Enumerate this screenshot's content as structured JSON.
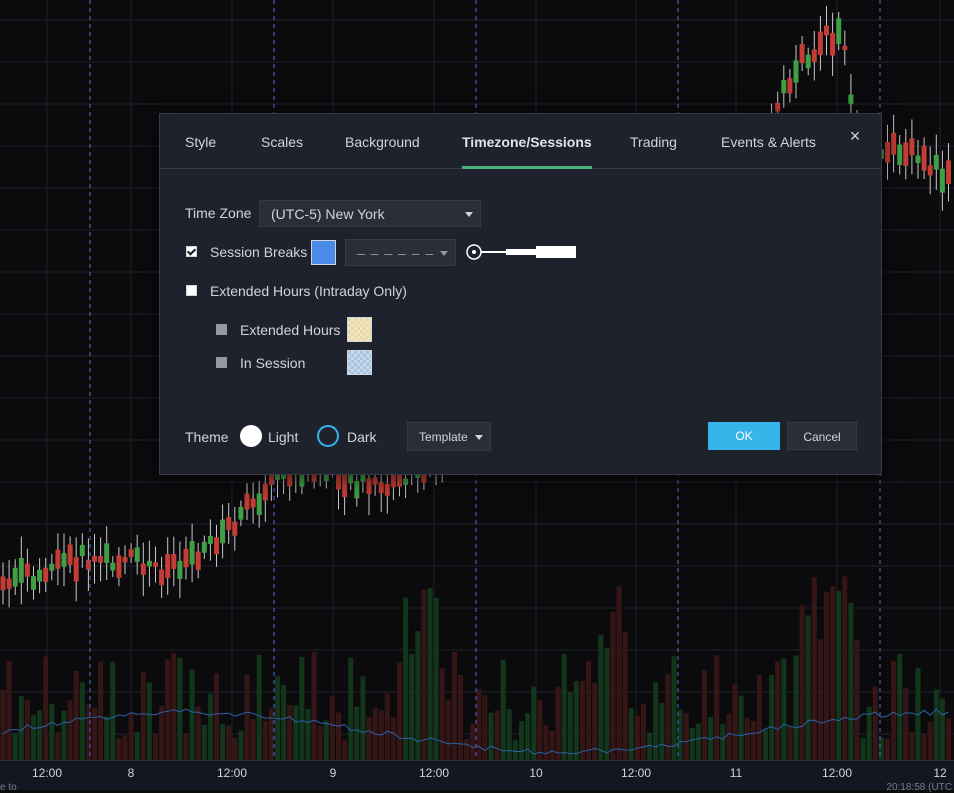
{
  "dialog": {
    "tabs": [
      {
        "label": "Style"
      },
      {
        "label": "Scales"
      },
      {
        "label": "Background"
      },
      {
        "label": "Timezone/Sessions"
      },
      {
        "label": "Trading"
      },
      {
        "label": "Events & Alerts"
      }
    ],
    "active_tab": "Timezone/Sessions",
    "close_symbol": "×",
    "timezone": {
      "label": "Time Zone",
      "value": "(UTC-5) New York"
    },
    "session_breaks": {
      "label": "Session Breaks",
      "checked": true,
      "color": "#4a8ae8",
      "line_style": "– – – – – –"
    },
    "extended_hours_group": {
      "label": "Extended Hours (Intraday Only)",
      "checked": false
    },
    "extended_hours": {
      "label": "Extended Hours",
      "color": "#e8d9a8"
    },
    "in_session": {
      "label": "In Session",
      "color": "#a8c4e0"
    },
    "theme": {
      "label": "Theme",
      "options": [
        "Light",
        "Dark"
      ],
      "selected": "Dark"
    },
    "template_label": "Template",
    "ok_label": "OK",
    "cancel_label": "Cancel"
  },
  "time_axis": {
    "labels": [
      "12:00",
      "8",
      "12:00",
      "9",
      "12:00",
      "10",
      "12:00",
      "11",
      "12:00",
      "12"
    ],
    "clock": "20:18:58 (UTC",
    "left_stub": "e to"
  },
  "colors": {
    "accent_green": "#4caf7d",
    "ok_blue": "#35b5ea",
    "up_candle": "#3f9f45",
    "down_candle": "#c33d34",
    "session_break_line": "#4a6fd8"
  }
}
